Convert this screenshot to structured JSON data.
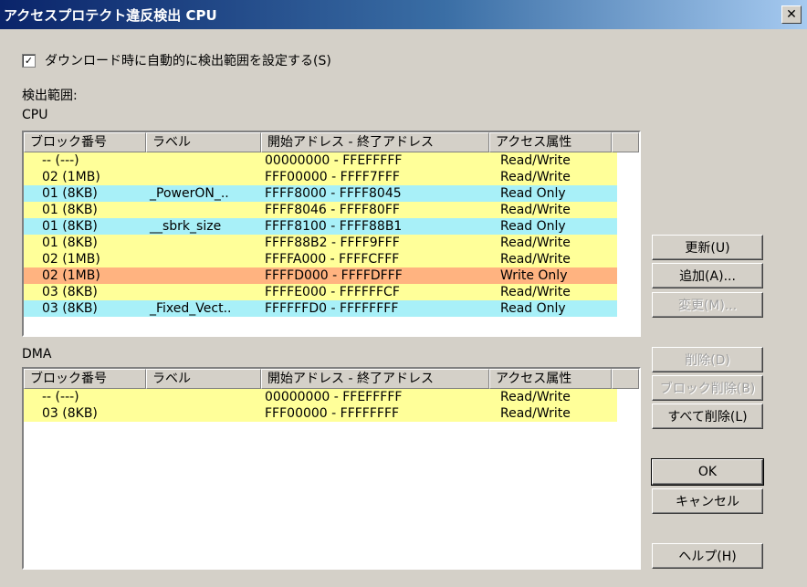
{
  "window": {
    "title": "アクセスプロテクト違反検出  CPU",
    "close_label": "✕"
  },
  "checkbox": {
    "checked_mark": "✓",
    "label": "ダウンロード時に自動的に検出範囲を設定する(S)"
  },
  "range_label": "検出範囲:",
  "cpu_label": "CPU",
  "dma_label": "DMA",
  "columns": [
    "ブロック番号",
    "ラベル",
    "開始アドレス - 終了アドレス",
    "アクセス属性",
    ""
  ],
  "colors": {
    "read_write": "#ffff99",
    "read_only": "#a8f0f8",
    "write_only": "#ffb380"
  },
  "cpu_rows": [
    {
      "block": "-- (---)",
      "label": "",
      "range": "00000000 - FFEFFFFF",
      "access": "Read/Write"
    },
    {
      "block": "02 (1MB)",
      "label": "",
      "range": "FFF00000 - FFFF7FFF",
      "access": "Read/Write"
    },
    {
      "block": "01 (8KB)",
      "label": "_PowerON_..",
      "range": "FFFF8000 - FFFF8045",
      "access": "Read Only"
    },
    {
      "block": "01 (8KB)",
      "label": "",
      "range": "FFFF8046 - FFFF80FF",
      "access": "Read/Write"
    },
    {
      "block": "01 (8KB)",
      "label": "__sbrk_size",
      "range": "FFFF8100 - FFFF88B1",
      "access": "Read Only"
    },
    {
      "block": "01 (8KB)",
      "label": "",
      "range": "FFFF88B2 - FFFF9FFF",
      "access": "Read/Write"
    },
    {
      "block": "02 (1MB)",
      "label": "",
      "range": "FFFFA000 - FFFFCFFF",
      "access": "Read/Write"
    },
    {
      "block": "02 (1MB)",
      "label": "",
      "range": "FFFFD000 - FFFFDFFF",
      "access": "Write Only"
    },
    {
      "block": "03 (8KB)",
      "label": "",
      "range": "FFFFE000 - FFFFFFCF",
      "access": "Read/Write"
    },
    {
      "block": "03 (8KB)",
      "label": "_Fixed_Vect..",
      "range": "FFFFFFD0 - FFFFFFFF",
      "access": "Read Only"
    }
  ],
  "dma_rows": [
    {
      "block": "-- (---)",
      "label": "",
      "range": "00000000 - FFEFFFFF",
      "access": "Read/Write"
    },
    {
      "block": "03 (8KB)",
      "label": "",
      "range": "FFF00000 - FFFFFFFF",
      "access": "Read/Write"
    }
  ],
  "buttons": {
    "update": "更新(U)",
    "add": "追加(A)...",
    "change": "変更(M)...",
    "delete": "削除(D)",
    "block_delete": "ブロック削除(B)",
    "delete_all": "すべて削除(L)",
    "ok": "OK",
    "cancel": "キャンセル",
    "help": "ヘルプ(H)"
  }
}
